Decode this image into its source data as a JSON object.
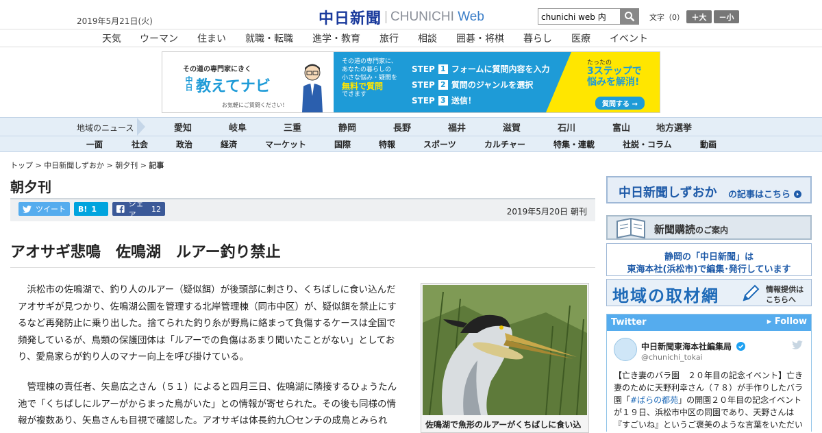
{
  "header": {
    "date": "2019年5月21日(火)",
    "logo_jp": "中日新聞",
    "logo_en": "CHUNICHI",
    "logo_web": "Web",
    "search_value": "chunichi web 内",
    "font_label": "文字（0）",
    "font_larger": "＋大",
    "font_smaller": "－小"
  },
  "category_nav": [
    "天気",
    "ウーマン",
    "住まい",
    "就職・転職",
    "進学・教育",
    "旅行",
    "相談",
    "囲碁・将棋",
    "暮らし",
    "医療",
    "イベント"
  ],
  "banner": {
    "sub": "その道の専門家にきく",
    "pre": "中日",
    "title": "教えてナビ",
    "note": "お気軽にご質問ください！",
    "desc_1": "その道の専門家に、",
    "desc_2": "あなたの暮らしの",
    "desc_3": "小さな悩み・疑問を",
    "desc_free": "無料で質問",
    "desc_4": "できます",
    "step_label": "STEP",
    "steps": [
      {
        "num": "1",
        "text": "フォームに質問内容を入力"
      },
      {
        "num": "2",
        "text": "質問のジャンルを選択"
      },
      {
        "num": "3",
        "text": "送信！"
      }
    ],
    "right_small": "たったの",
    "right_big1": "3ステップで",
    "right_big2": "悩みを解消!",
    "right_btn": "質問する →"
  },
  "region": {
    "label": "地域のニュース",
    "items": [
      "愛知",
      "岐阜",
      "三重",
      "静岡",
      "長野",
      "福井",
      "滋賀",
      "石川",
      "富山",
      "地方選挙"
    ]
  },
  "sections": [
    "一面",
    "社会",
    "政治",
    "経済",
    "マーケット",
    "国際",
    "特報",
    "スポーツ",
    "カルチャー",
    "特集・連載",
    "社説・コラム",
    "動画"
  ],
  "breadcrumb": {
    "top": "トップ",
    "sep": " > ",
    "mid": "中日新聞しずおか",
    "sub": "朝夕刊",
    "current": "記事"
  },
  "section_title": "朝夕刊",
  "share": {
    "tweet": "ツイート",
    "hatena_label": "B!",
    "hatena_count": "1",
    "facebook_label": "シェア",
    "facebook_count": "12"
  },
  "pub_date": "2019年5月20日 朝刊",
  "article": {
    "headline": "アオサギ悲鳴　佐鳴湖　ルアー釣り禁止",
    "p1_l1": "浜松市の佐鳴湖で、釣り人のルアー（疑似餌）が後頭部に刺さり、くちばしに食い込んだ",
    "p1_l2": "アオサギが見つかり、佐鳴湖公園を管理する北岸管理棟（同市中区）が、疑似餌を禁止にす",
    "p1_l3": "るなど再発防止に乗り出した。捨てられた釣り糸が野鳥に絡まって負傷するケースは全国で",
    "p1_l4": "頻発しているが、鳥類の保護団体は「ルアーでの負傷はあまり聞いたことがない」としてお",
    "p1_l5": "り、愛鳥家らが釣り人のマナー向上を呼び掛けている。",
    "p2_l1": "管理棟の責任者、矢島広之さん（５１）によると四月三日、佐鳴湖に隣接するひょうたん",
    "p2_l2": "池で「くちばしにルアーがからまった鳥がいた」との情報が寄せられた。その後も同様の情",
    "p2_l3": "報が複数あり、矢島さんも目視で確認した。アオサギは体長約九〇センチの成鳥とみられ",
    "photo_caption": "佐鳴湖で魚形のルアーがくちばしに食い込"
  },
  "sidebar": {
    "shizuoka_title": "中日新聞しずおか",
    "shizuoka_suffix": "の記事はこちら",
    "subscribe_title": "新聞購読",
    "subscribe_suffix": "のご案内",
    "hq_line1": "静岡の「中日新聞」は",
    "hq_line2": "東海本社(浜松市)で編集･発行しています",
    "local_title": "地域の取材網",
    "local_r1": "情報提供は",
    "local_r2": "こちらへ"
  },
  "twitter": {
    "header": "Twitter",
    "follow": "▸ Follow",
    "name": "中日新聞東海本社編集局",
    "handle": "@chunichi_tokai",
    "text_1": "【亡き妻のバラ園　２０年目の記念イベント】亡き妻のために天野利幸さん（７８）が手作りしたバラ園「",
    "tag": "#ばらの都苑",
    "text_2": "」の開園２０年目の記念イベントが１９日、浜松市中区の同園であり、天野さんは『すごいね』というご褒美のような言葉をいただい"
  },
  "colors": {
    "brand_blue": "#1a3a9c",
    "twitter": "#55acee",
    "facebook": "#3b5998",
    "hatena": "#00a4de",
    "banner_blue": "#1e9bd7",
    "banner_yellow": "#ffe600"
  }
}
